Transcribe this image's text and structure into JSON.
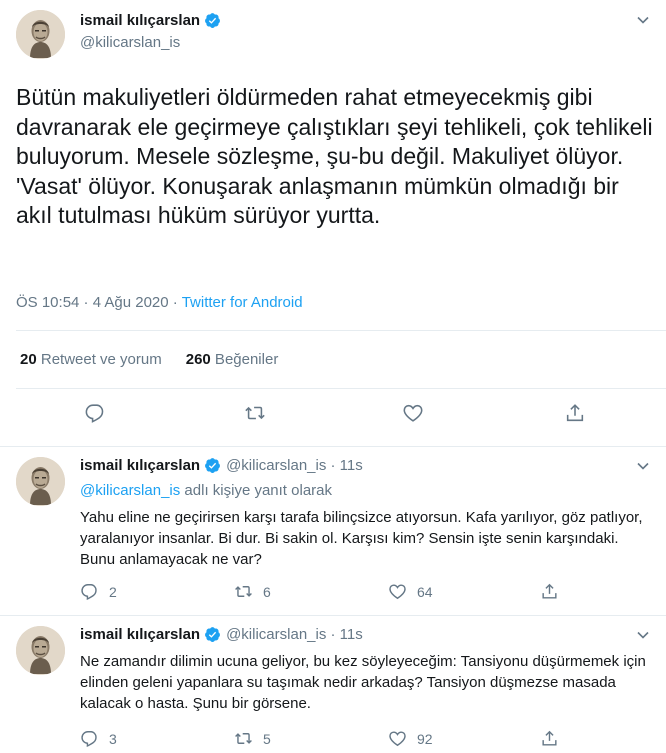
{
  "main": {
    "display_name": "ismail kılıçarslan",
    "handle": "@kilicarslan_is",
    "text": "Bütün makuliyetleri öldürmeden rahat etmeyecekmiş gibi davranarak ele geçirmeye çalıştıkları şeyi tehlikeli, çok tehlikeli buluyorum. Mesele sözleşme, şu-bu değil. Makuliyet ölüyor. 'Vasat' ölüyor. Konuşarak anlaşmanın mümkün olmadığı bir akıl tutulması hüküm sürüyor yurtta.",
    "time": "ÖS 10:54 · 4 Ağu 2020 · ",
    "source": "Twitter for Android",
    "retweet_count": "20",
    "retweet_label": " Retweet ve yorum",
    "like_count": "260",
    "like_label": " Beğeniler"
  },
  "replies": [
    {
      "display_name": "ismail kılıçarslan",
      "handle_time": "@kilicarslan_is · 11s",
      "replying_handle": "@kilicarslan_is",
      "replying_suffix": " adlı kişiye yanıt olarak",
      "text": "Yahu eline ne geçirirsen karşı tarafa bilinçsizce atıyorsun. Kafa yarılıyor, göz patlıyor, yaralanıyor insanlar. Bi dur. Bi sakin ol. Karşısı kim? Sensin işte senin karşındaki. Bunu anlamayacak ne var?",
      "reply_count": "2",
      "retweet_count": "6",
      "like_count": "64"
    },
    {
      "display_name": "ismail kılıçarslan",
      "handle_time": "@kilicarslan_is · 11s",
      "text": "Ne zamandır dilimin ucuna geliyor, bu kez söyleyeceğim: Tansiyonu düşürmemek için elinden geleni yapanlara su taşımak nedir arkadaş? Tansiyon düşmezse masada kalacak o hasta. Şunu bir görsene.",
      "reply_count": "3",
      "retweet_count": "5",
      "like_count": "92"
    }
  ],
  "icons": {
    "verified": "verified-badge-icon",
    "caret": "chevron-down-icon",
    "reply": "reply-bubble-icon",
    "retweet": "retweet-icon",
    "like": "heart-icon",
    "share": "share-icon"
  },
  "colors": {
    "accent": "#1da1f2",
    "secondary_text": "#657786",
    "primary_text": "#14171a",
    "divider": "#e6ecf0"
  }
}
